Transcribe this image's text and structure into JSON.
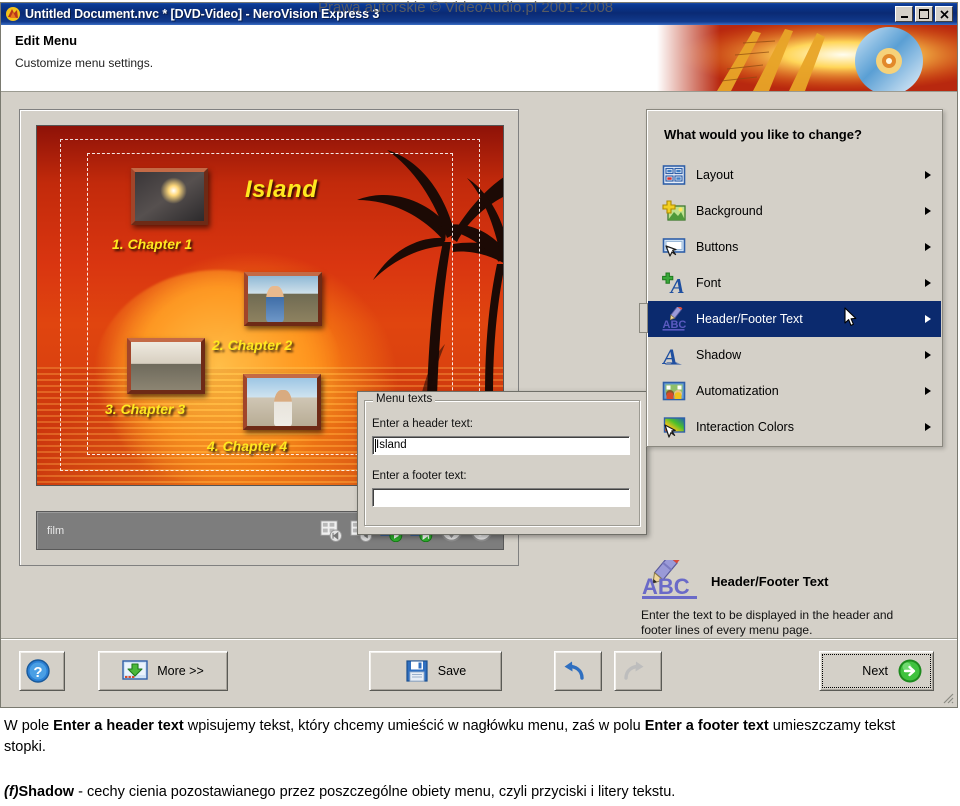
{
  "watermark": "Prawa autorskie © VideoAudio.pl 2001-2008",
  "window": {
    "title": "Untitled Document.nvc * [DVD-Video] - NeroVision Express 3",
    "controls": {
      "minimize": "_",
      "maximize": "□",
      "close": "×"
    }
  },
  "header": {
    "title": "Edit Menu",
    "subtitle": "Customize menu settings."
  },
  "preview": {
    "menu_title": "Island",
    "chapters": [
      "1. Chapter 1",
      "2. Chapter 2",
      "3. Chapter 3",
      "4. Chapter 4"
    ],
    "bottom_bar": {
      "label": "film",
      "icons": [
        "first-page-icon",
        "previous-page-icon",
        "next-page-icon",
        "last-page-icon",
        "menu-structure-icon",
        "confirm-icon"
      ]
    }
  },
  "dialog": {
    "group_title": "Menu texts",
    "header_label": "Enter a header text:",
    "header_value": "Island",
    "header_placeholder": "",
    "footer_label": "Enter a footer text:",
    "footer_value": "",
    "footer_placeholder": ""
  },
  "right_panel": {
    "heading": "What would you like to change?",
    "items": [
      {
        "label": "Layout",
        "icon": "layout-icon",
        "selected": false
      },
      {
        "label": "Background",
        "icon": "background-icon",
        "selected": false
      },
      {
        "label": "Buttons",
        "icon": "buttons-icon",
        "selected": false
      },
      {
        "label": "Font",
        "icon": "font-icon",
        "selected": false
      },
      {
        "label": "Header/Footer Text",
        "icon": "header-footer-text-icon",
        "selected": true
      },
      {
        "label": "Shadow",
        "icon": "shadow-icon",
        "selected": false
      },
      {
        "label": "Automatization",
        "icon": "automatization-icon",
        "selected": false
      },
      {
        "label": "Interaction Colors",
        "icon": "interaction-colors-icon",
        "selected": false
      }
    ]
  },
  "info_box": {
    "icon": "abc-pencil-icon",
    "title": "Header/Footer Text",
    "description": "Enter the text to be displayed in the header and footer lines of every menu page."
  },
  "footer": {
    "help_label": "",
    "more_label": "More >>",
    "save_label": "Save",
    "undo_label": "",
    "redo_label": "",
    "next_label": "Next"
  },
  "caption": {
    "p1_a": "W pole ",
    "p1_b1": "Enter a header text",
    "p1_c": " wpisujemy tekst, który chcemy umieścić w nagłówku menu, zaś w polu ",
    "p1_b2": "Enter a footer text",
    "p1_d": " umieszczamy tekst stopki.",
    "p2_marker": "(f)",
    "p2_bold": "Shadow",
    "p2_rest": " - cechy cienia pozostawianego przez poszczególne obiety menu, czyli przyciski i litery tekstu."
  },
  "colors": {
    "titlebar_blue": "#0a2a74",
    "selection_navy": "#0b2a6e",
    "chrome_gray": "#d4d0c8",
    "menu_yellow": "#ffe81f",
    "accent_green": "#2aa02a"
  }
}
